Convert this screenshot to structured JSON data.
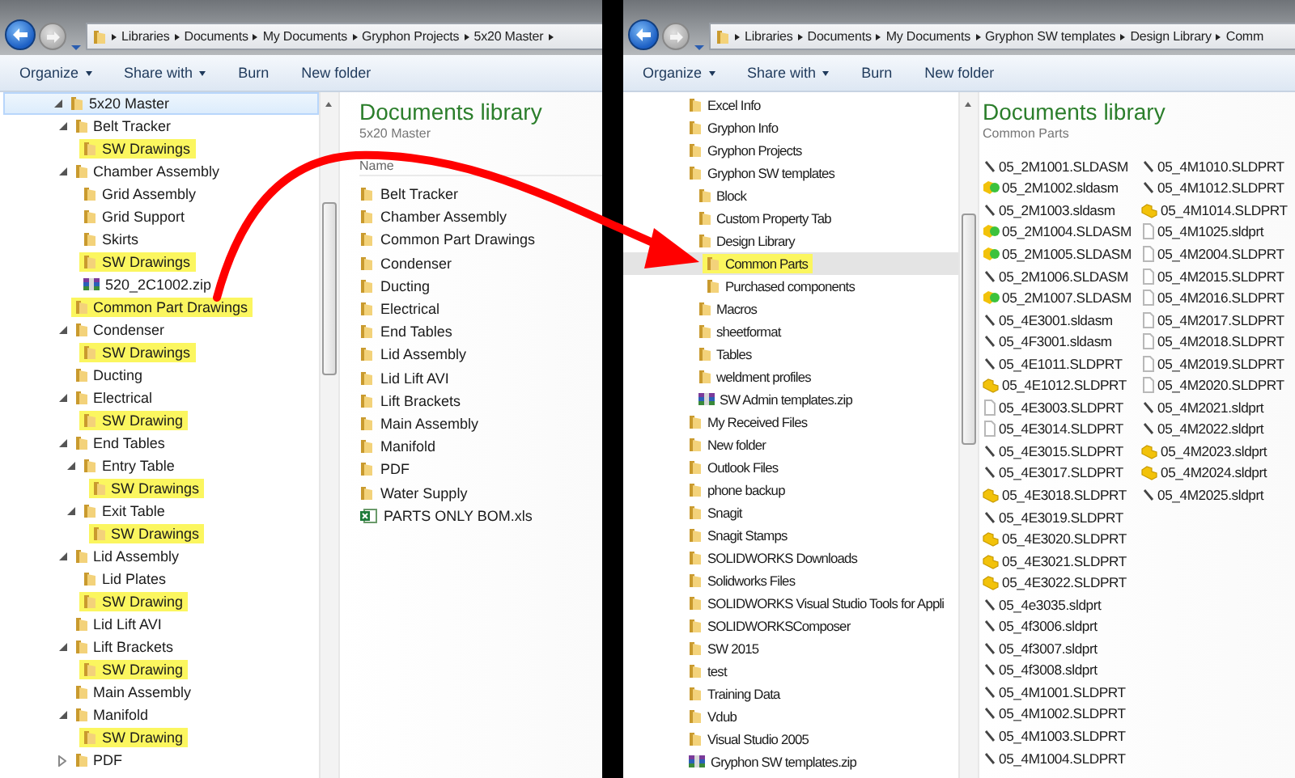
{
  "windows": [
    {
      "active": true,
      "address": {
        "crumbs": [
          "Libraries",
          "Documents",
          "My Documents",
          "Gryphon Projects",
          "5x20 Master"
        ],
        "trailing_chevron": true
      },
      "toolbar": [
        {
          "label": "Organize",
          "menu": true
        },
        {
          "label": "Share with",
          "menu": true
        },
        {
          "label": "Burn",
          "menu": false
        },
        {
          "label": "New folder",
          "menu": false
        }
      ],
      "tree": [
        {
          "label": "5x20 Master",
          "kind": "folder",
          "expander": true,
          "expanded": true,
          "highlighted": false,
          "selected": true,
          "children": [
            {
              "label": "Belt Tracker",
              "kind": "folder",
              "expander": true,
              "expanded": true,
              "highlighted": false,
              "selected": false,
              "children": [
                {
                  "label": "SW Drawings",
                  "kind": "folder",
                  "expander": false,
                  "highlighted": true,
                  "selected": false
                }
              ]
            },
            {
              "label": "Chamber Assembly",
              "kind": "folder",
              "expander": true,
              "expanded": true,
              "highlighted": false,
              "selected": false,
              "children": [
                {
                  "label": "Grid Assembly",
                  "kind": "folder",
                  "expander": false,
                  "highlighted": false,
                  "selected": false
                },
                {
                  "label": "Grid Support",
                  "kind": "folder",
                  "expander": false,
                  "highlighted": false,
                  "selected": false
                },
                {
                  "label": "Skirts",
                  "kind": "folder",
                  "expander": false,
                  "highlighted": false,
                  "selected": false
                },
                {
                  "label": "SW Drawings",
                  "kind": "folder",
                  "expander": false,
                  "highlighted": true,
                  "selected": false
                },
                {
                  "label": "520_2C1002.zip",
                  "kind": "zip",
                  "expander": false,
                  "highlighted": false,
                  "selected": false
                }
              ]
            },
            {
              "label": "Common Part Drawings",
              "kind": "folder",
              "expander": false,
              "highlighted": true,
              "selected": false
            },
            {
              "label": "Condenser",
              "kind": "folder",
              "expander": true,
              "expanded": true,
              "highlighted": false,
              "selected": false,
              "children": [
                {
                  "label": "SW Drawings",
                  "kind": "folder",
                  "expander": false,
                  "highlighted": true,
                  "selected": false
                }
              ]
            },
            {
              "label": "Ducting",
              "kind": "folder",
              "expander": false,
              "highlighted": false,
              "selected": false
            },
            {
              "label": "Electrical",
              "kind": "folder",
              "expander": true,
              "expanded": true,
              "highlighted": false,
              "selected": false,
              "children": [
                {
                  "label": "SW Drawing",
                  "kind": "folder",
                  "expander": false,
                  "highlighted": true,
                  "selected": false
                }
              ]
            },
            {
              "label": "End Tables",
              "kind": "folder",
              "expander": true,
              "expanded": true,
              "highlighted": false,
              "selected": false,
              "children": [
                {
                  "label": "Entry Table",
                  "kind": "folder",
                  "expander": true,
                  "expanded": true,
                  "highlighted": false,
                  "selected": false,
                  "children": [
                    {
                      "label": "SW Drawings",
                      "kind": "folder",
                      "expander": false,
                      "highlighted": true,
                      "selected": false
                    }
                  ]
                },
                {
                  "label": "Exit Table",
                  "kind": "folder",
                  "expander": true,
                  "expanded": true,
                  "highlighted": false,
                  "selected": false,
                  "children": [
                    {
                      "label": "SW Drawings",
                      "kind": "folder",
                      "expander": false,
                      "highlighted": true,
                      "selected": false
                    }
                  ]
                }
              ]
            },
            {
              "label": "Lid Assembly",
              "kind": "folder",
              "expander": true,
              "expanded": true,
              "highlighted": false,
              "selected": false,
              "children": [
                {
                  "label": "Lid Plates",
                  "kind": "folder",
                  "expander": false,
                  "highlighted": false,
                  "selected": false
                },
                {
                  "label": "SW Drawing",
                  "kind": "folder",
                  "expander": false,
                  "highlighted": true,
                  "selected": false
                }
              ]
            },
            {
              "label": "Lid Lift AVI",
              "kind": "folder",
              "expander": false,
              "highlighted": false,
              "selected": false
            },
            {
              "label": "Lift Brackets",
              "kind": "folder",
              "expander": true,
              "expanded": true,
              "highlighted": false,
              "selected": false,
              "children": [
                {
                  "label": "SW Drawing",
                  "kind": "folder",
                  "expander": false,
                  "highlighted": true,
                  "selected": false
                }
              ]
            },
            {
              "label": "Main Assembly",
              "kind": "folder",
              "expander": false,
              "highlighted": false,
              "selected": false
            },
            {
              "label": "Manifold",
              "kind": "folder",
              "expander": true,
              "expanded": true,
              "highlighted": false,
              "selected": false,
              "children": [
                {
                  "label": "SW Drawing",
                  "kind": "folder",
                  "expander": false,
                  "highlighted": true,
                  "selected": false
                }
              ]
            },
            {
              "label": "PDF",
              "kind": "folder",
              "expander": true,
              "expanded": false,
              "highlighted": false,
              "selected": false
            }
          ]
        }
      ],
      "content": {
        "title": "Documents library",
        "subtitle": "5x20 Master",
        "kind": "details",
        "columns": [
          "Name"
        ],
        "items": [
          {
            "name": "Belt Tracker",
            "kind": "folder"
          },
          {
            "name": "Chamber Assembly",
            "kind": "folder"
          },
          {
            "name": "Common Part Drawings",
            "kind": "folder"
          },
          {
            "name": "Condenser",
            "kind": "folder"
          },
          {
            "name": "Ducting",
            "kind": "folder"
          },
          {
            "name": "Electrical",
            "kind": "folder"
          },
          {
            "name": "End Tables",
            "kind": "folder"
          },
          {
            "name": "Lid Assembly",
            "kind": "folder"
          },
          {
            "name": "Lid Lift AVI",
            "kind": "folder"
          },
          {
            "name": "Lift Brackets",
            "kind": "folder"
          },
          {
            "name": "Main Assembly",
            "kind": "folder"
          },
          {
            "name": "Manifold",
            "kind": "folder"
          },
          {
            "name": "PDF",
            "kind": "folder"
          },
          {
            "name": "Water Supply",
            "kind": "folder"
          },
          {
            "name": "PARTS ONLY BOM.xls",
            "kind": "spreadsheet"
          }
        ]
      }
    },
    {
      "active": false,
      "address": {
        "crumbs": [
          "Libraries",
          "Documents",
          "My Documents",
          "Gryphon SW templates",
          "Design Library",
          "Comm"
        ],
        "trailing_chevron": false
      },
      "toolbar": [
        {
          "label": "Organize",
          "menu": true
        },
        {
          "label": "Share with",
          "menu": true
        },
        {
          "label": "Burn",
          "menu": false
        },
        {
          "label": "New folder",
          "menu": false
        }
      ],
      "tree": [
        {
          "label": "Excel Info",
          "kind": "folder",
          "highlighted": false,
          "selected": false
        },
        {
          "label": "Gryphon Info",
          "kind": "folder",
          "highlighted": false,
          "selected": false
        },
        {
          "label": "Gryphon Projects",
          "kind": "folder",
          "highlighted": false,
          "selected": false
        },
        {
          "label": "Gryphon SW templates",
          "kind": "folder",
          "highlighted": false,
          "selected": false,
          "children": [
            {
              "label": "Block",
              "kind": "folder",
              "highlighted": false,
              "selected": false
            },
            {
              "label": "Custom Property Tab",
              "kind": "folder",
              "highlighted": false,
              "selected": false
            },
            {
              "label": "Design Library",
              "kind": "folder",
              "highlighted": false,
              "selected": false,
              "children": [
                {
                  "label": "Common Parts",
                  "kind": "folder",
                  "highlighted": true,
                  "selected": true
                },
                {
                  "label": "Purchased components",
                  "kind": "folder",
                  "highlighted": false,
                  "selected": false
                }
              ]
            },
            {
              "label": "Macros",
              "kind": "folder",
              "highlighted": false,
              "selected": false
            },
            {
              "label": "sheetformat",
              "kind": "folder",
              "highlighted": false,
              "selected": false
            },
            {
              "label": "Tables",
              "kind": "folder",
              "highlighted": false,
              "selected": false
            },
            {
              "label": "weldment profiles",
              "kind": "folder",
              "highlighted": false,
              "selected": false
            },
            {
              "label": "SW Admin templates.zip",
              "kind": "zip",
              "highlighted": false,
              "selected": false
            }
          ]
        },
        {
          "label": "My Received Files",
          "kind": "folder",
          "highlighted": false,
          "selected": false
        },
        {
          "label": "New folder",
          "kind": "folder",
          "highlighted": false,
          "selected": false
        },
        {
          "label": "Outlook Files",
          "kind": "folder",
          "highlighted": false,
          "selected": false
        },
        {
          "label": "phone backup",
          "kind": "folder",
          "highlighted": false,
          "selected": false
        },
        {
          "label": "Snagit",
          "kind": "folder",
          "highlighted": false,
          "selected": false
        },
        {
          "label": "Snagit Stamps",
          "kind": "folder",
          "highlighted": false,
          "selected": false
        },
        {
          "label": "SOLIDWORKS Downloads",
          "kind": "folder",
          "highlighted": false,
          "selected": false
        },
        {
          "label": "Solidworks Files",
          "kind": "folder",
          "highlighted": false,
          "selected": false
        },
        {
          "label": "SOLIDWORKS Visual Studio Tools for Appli",
          "kind": "folder",
          "highlighted": false,
          "selected": false
        },
        {
          "label": "SOLIDWORKSComposer",
          "kind": "folder",
          "highlighted": false,
          "selected": false
        },
        {
          "label": "SW 2015",
          "kind": "folder",
          "highlighted": false,
          "selected": false
        },
        {
          "label": "test",
          "kind": "folder",
          "highlighted": false,
          "selected": false
        },
        {
          "label": "Training Data",
          "kind": "folder",
          "highlighted": false,
          "selected": false
        },
        {
          "label": "Vdub",
          "kind": "folder",
          "highlighted": false,
          "selected": false
        },
        {
          "label": "Visual Studio 2005",
          "kind": "folder",
          "highlighted": false,
          "selected": false
        },
        {
          "label": "Gryphon SW templates.zip",
          "kind": "zip",
          "highlighted": false,
          "selected": false
        }
      ],
      "content": {
        "title": "Documents library",
        "subtitle": "Common Parts",
        "kind": "list",
        "items": [
          {
            "name": "05_2M1001.SLDASM",
            "kind": "glyph"
          },
          {
            "name": "05_2M1002.sldasm",
            "kind": "assembly"
          },
          {
            "name": "05_2M1003.sldasm",
            "kind": "glyph"
          },
          {
            "name": "05_2M1004.SLDASM",
            "kind": "assembly"
          },
          {
            "name": "05_2M1005.SLDASM",
            "kind": "assembly"
          },
          {
            "name": "05_2M1006.SLDASM",
            "kind": "glyph"
          },
          {
            "name": "05_2M1007.SLDASM",
            "kind": "assembly"
          },
          {
            "name": "05_4E3001.sldasm",
            "kind": "glyph"
          },
          {
            "name": "05_4F3001.sldasm",
            "kind": "glyph"
          },
          {
            "name": "05_4E1011.SLDPRT",
            "kind": "glyph"
          },
          {
            "name": "05_4E1012.SLDPRT",
            "kind": "part"
          },
          {
            "name": "05_4E3003.SLDPRT",
            "kind": "document"
          },
          {
            "name": "05_4E3014.SLDPRT",
            "kind": "document"
          },
          {
            "name": "05_4E3015.SLDPRT",
            "kind": "glyph"
          },
          {
            "name": "05_4E3017.SLDPRT",
            "kind": "glyph"
          },
          {
            "name": "05_4E3018.SLDPRT",
            "kind": "part"
          },
          {
            "name": "05_4E3019.SLDPRT",
            "kind": "glyph"
          },
          {
            "name": "05_4E3020.SLDPRT",
            "kind": "part"
          },
          {
            "name": "05_4E3021.SLDPRT",
            "kind": "part"
          },
          {
            "name": "05_4E3022.SLDPRT",
            "kind": "part"
          },
          {
            "name": "05_4e3035.sldprt",
            "kind": "glyph"
          },
          {
            "name": "05_4f3006.sldprt",
            "kind": "glyph"
          },
          {
            "name": "05_4f3007.sldprt",
            "kind": "glyph"
          },
          {
            "name": "05_4f3008.sldprt",
            "kind": "glyph"
          },
          {
            "name": "05_4M1001.SLDPRT",
            "kind": "glyph"
          },
          {
            "name": "05_4M1002.SLDPRT",
            "kind": "glyph"
          },
          {
            "name": "05_4M1003.SLDPRT",
            "kind": "glyph"
          },
          {
            "name": "05_4M1004.SLDPRT",
            "kind": "glyph"
          },
          {
            "name": "05_4M1010.SLDPRT",
            "kind": "glyph"
          },
          {
            "name": "05_4M1012.SLDPRT",
            "kind": "glyph"
          },
          {
            "name": "05_4M1014.SLDPRT",
            "kind": "part"
          },
          {
            "name": "05_4M1025.sldprt",
            "kind": "document"
          },
          {
            "name": "05_4M2004.SLDPRT",
            "kind": "document"
          },
          {
            "name": "05_4M2015.SLDPRT",
            "kind": "document"
          },
          {
            "name": "05_4M2016.SLDPRT",
            "kind": "document"
          },
          {
            "name": "05_4M2017.SLDPRT",
            "kind": "document"
          },
          {
            "name": "05_4M2018.SLDPRT",
            "kind": "document"
          },
          {
            "name": "05_4M2019.SLDPRT",
            "kind": "document"
          },
          {
            "name": "05_4M2020.SLDPRT",
            "kind": "document"
          },
          {
            "name": "05_4M2021.sldprt",
            "kind": "glyph"
          },
          {
            "name": "05_4M2022.sldprt",
            "kind": "glyph"
          },
          {
            "name": "05_4M2023.sldprt",
            "kind": "part"
          },
          {
            "name": "05_4M2024.sldprt",
            "kind": "part"
          },
          {
            "name": "05_4M2025.sldprt",
            "kind": "glyph"
          }
        ]
      }
    }
  ]
}
